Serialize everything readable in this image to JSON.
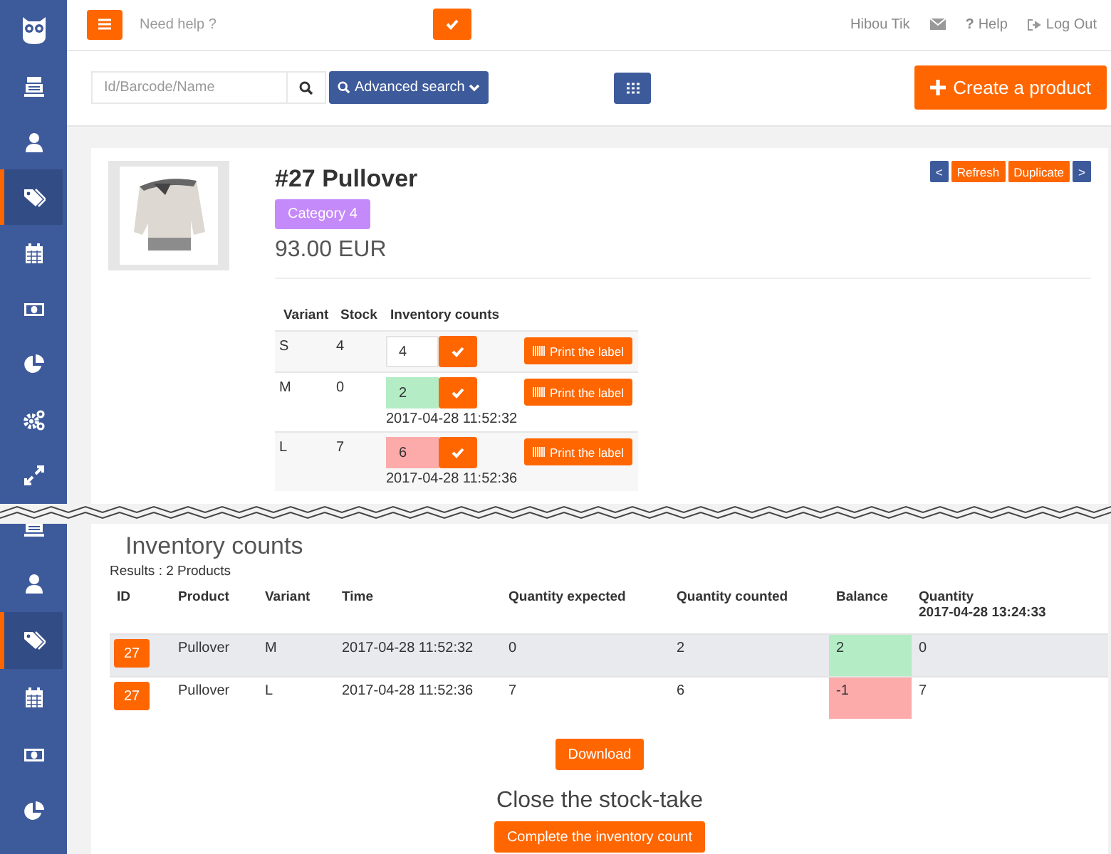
{
  "sidebar_upper": [
    {
      "kind": "register",
      "selected": false
    },
    {
      "kind": "user",
      "selected": false
    },
    {
      "kind": "tag",
      "selected": true
    },
    {
      "kind": "calendar",
      "selected": false
    },
    {
      "kind": "money",
      "selected": false
    },
    {
      "kind": "pie",
      "selected": false
    },
    {
      "kind": "gears",
      "selected": false
    },
    {
      "kind": "expand",
      "selected": false
    }
  ],
  "header": {
    "help_search": {
      "placeholder": "Need help ?"
    },
    "user_name": "Hibou Tik",
    "help_link": {
      "icon": "?",
      "label": "Help"
    },
    "logout_label": "Log Out"
  },
  "toolbar": {
    "search": {
      "placeholder": "Id/Barcode/Name"
    },
    "advanced_search": "Advanced search",
    "create_button": "Create a product"
  },
  "product": {
    "title": "#27 Pullover",
    "category": "Category 4",
    "price": "93.00 EUR",
    "nav": [
      {
        "label": "<",
        "kind": "arrow"
      },
      {
        "label": "Refresh",
        "kind": "action"
      },
      {
        "label": "Duplicate",
        "kind": "action"
      },
      {
        "label": ">",
        "kind": "arrow"
      }
    ],
    "variants": {
      "columns": [
        "Variant",
        "Stock",
        "Inventory counts"
      ],
      "rows": [
        {
          "variant": "S",
          "stock": "4",
          "count": "4",
          "color": "#ffffff",
          "print_label": "Print the label"
        },
        {
          "variant": "M",
          "stock": "0",
          "count": "2",
          "color": "#b3ecc5",
          "time": "2017-04-28 11:52:32",
          "print_label": "Print the label"
        },
        {
          "variant": "L",
          "stock": "7",
          "count": "6",
          "color": "#fdaaaa",
          "time": "2017-04-28 11:52:36",
          "print_label": "Print the label"
        }
      ]
    }
  },
  "sidebar_lower": [
    {
      "kind": "register",
      "selected": false
    },
    {
      "kind": "user",
      "selected": false
    },
    {
      "kind": "tag",
      "selected": true
    },
    {
      "kind": "calendar",
      "selected": false
    },
    {
      "kind": "money",
      "selected": false
    },
    {
      "kind": "pie",
      "selected": false
    }
  ],
  "inventory": {
    "title": "Inventory counts",
    "results": "Results : 2 Products",
    "columns": [
      {
        "label": "ID"
      },
      {
        "label": "Product"
      },
      {
        "label": "Variant"
      },
      {
        "label": "Time"
      },
      {
        "label": "Quantity expected"
      },
      {
        "label": "Quantity counted"
      },
      {
        "label": "Balance"
      },
      {
        "label": "Quantity",
        "sub": "2017-04-28 13:24:33"
      }
    ],
    "rows": [
      {
        "id": "27",
        "product": "Pullover",
        "variant": "M",
        "time": "2017-04-28 11:52:32",
        "expected": "0",
        "counted": "2",
        "balance": "2",
        "color": "#b3ecc5",
        "quantity": "0"
      },
      {
        "id": "27",
        "product": "Pullover",
        "variant": "L",
        "time": "2017-04-28 11:52:36",
        "expected": "7",
        "counted": "6",
        "balance": "-1",
        "color": "#fdaaaa",
        "quantity": "7"
      }
    ],
    "download": "Download",
    "close_title": "Close the stock-take",
    "complete_button": "Complete the inventory count"
  }
}
